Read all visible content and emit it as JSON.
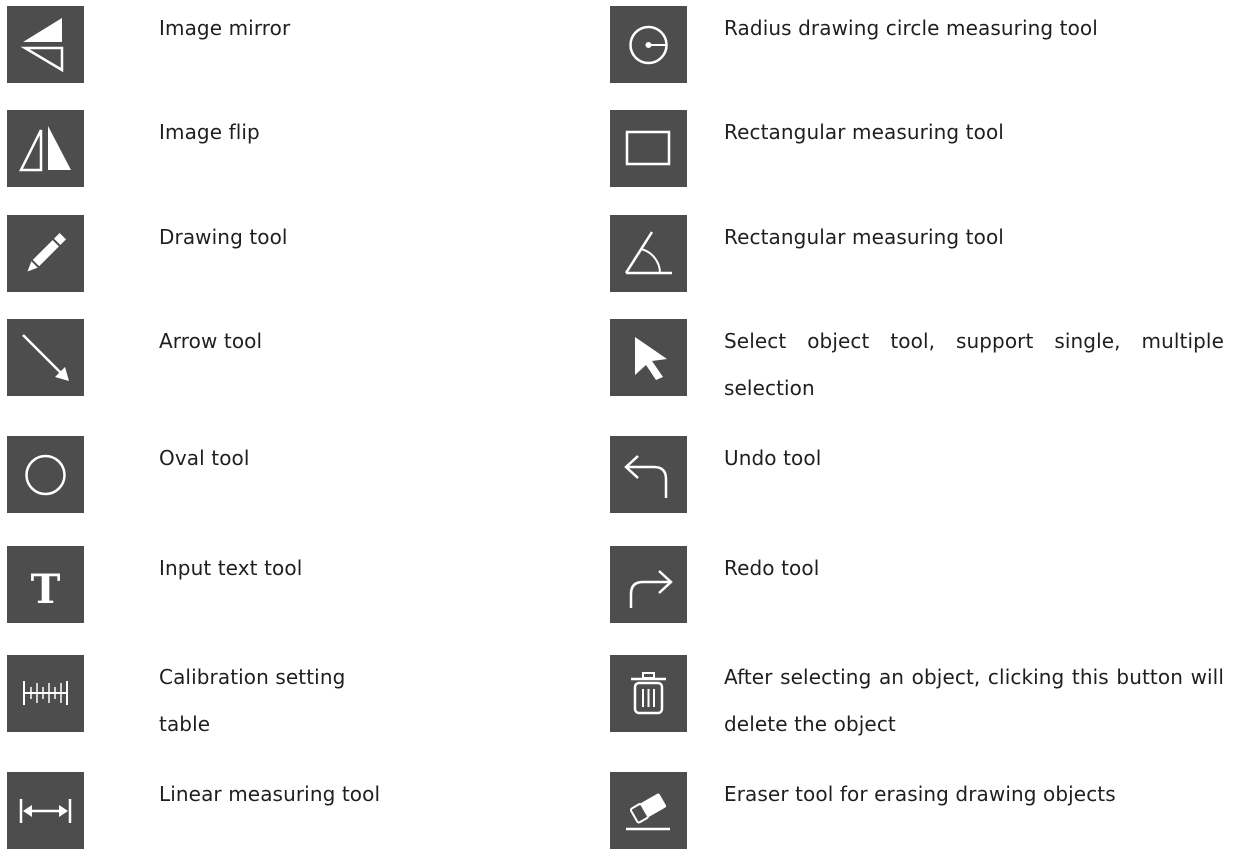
{
  "left_column": [
    {
      "icon": "image-mirror-icon",
      "text": "Image mirror"
    },
    {
      "icon": "image-flip-icon",
      "text": "Image flip"
    },
    {
      "icon": "pencil-icon",
      "text": "Drawing tool"
    },
    {
      "icon": "arrow-icon",
      "text": "Arrow tool"
    },
    {
      "icon": "oval-icon",
      "text": "Oval tool"
    },
    {
      "icon": "text-icon",
      "text": "Input text tool"
    },
    {
      "icon": "ruler-icon",
      "text": "Calibration setting table"
    },
    {
      "icon": "linear-measure-icon",
      "text": "Linear measuring tool"
    }
  ],
  "right_column": [
    {
      "icon": "radius-circle-icon",
      "text": "Radius drawing circle measuring tool"
    },
    {
      "icon": "rectangle-icon",
      "text": "Rectangular measuring tool"
    },
    {
      "icon": "angle-icon",
      "text": "Rectangular measuring tool"
    },
    {
      "icon": "cursor-icon",
      "text": "Select object tool, support single, multiple selection"
    },
    {
      "icon": "undo-icon",
      "text": "Undo tool"
    },
    {
      "icon": "redo-icon",
      "text": "Redo tool"
    },
    {
      "icon": "trash-icon",
      "text": "After selecting an object, clicking this button will delete the object"
    },
    {
      "icon": "eraser-icon",
      "text": "Eraser tool for erasing drawing objects"
    }
  ],
  "colors": {
    "tile_background": "#4d4d4d",
    "icon_stroke": "#ffffff"
  }
}
